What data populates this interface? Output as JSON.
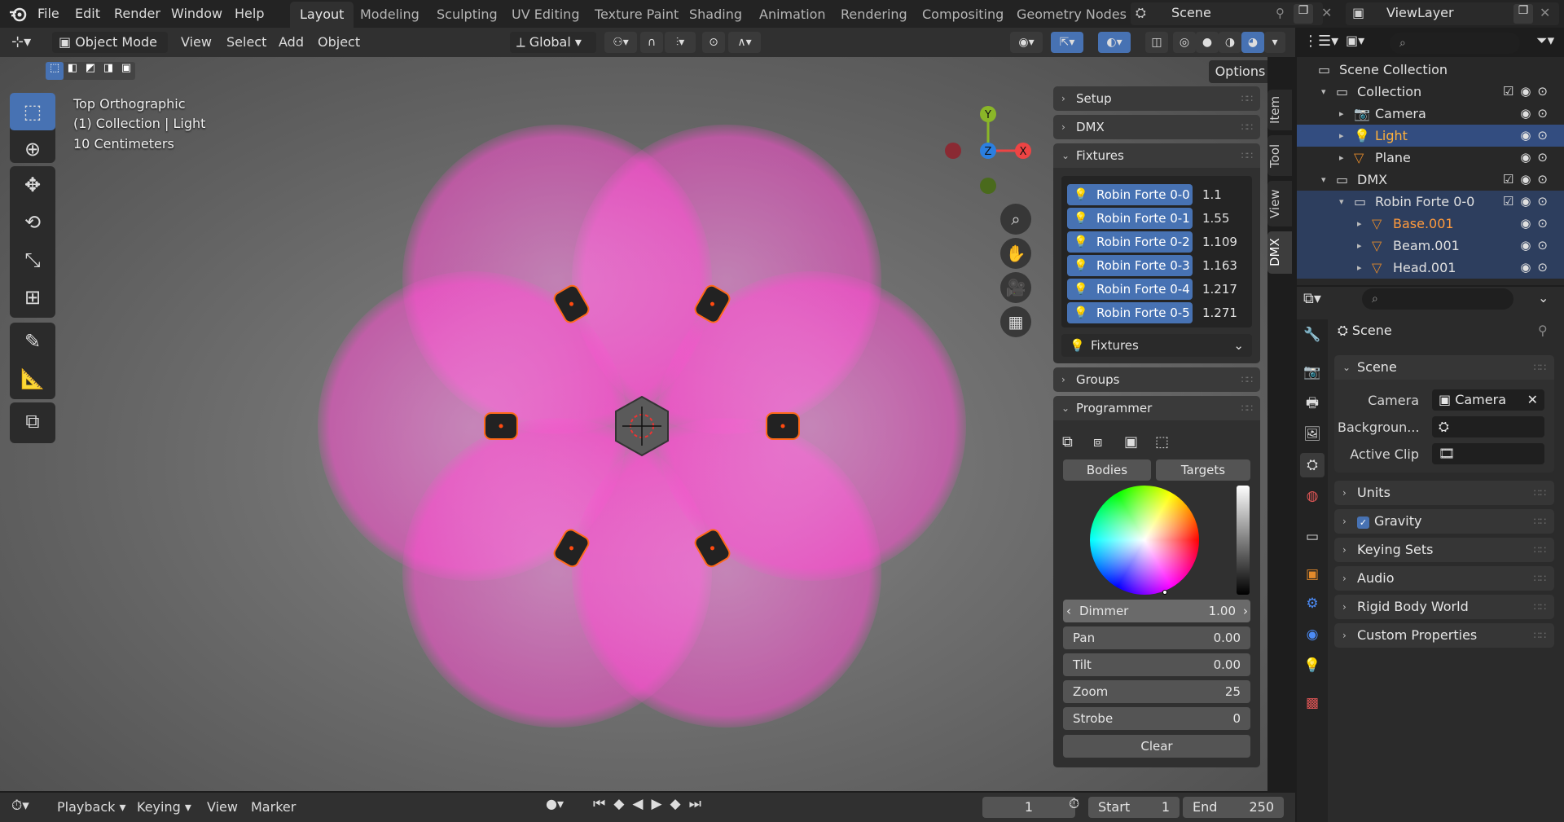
{
  "topbar": {
    "menus": [
      "File",
      "Edit",
      "Render",
      "Window",
      "Help"
    ],
    "workspaces": [
      "Layout",
      "Modeling",
      "Sculpting",
      "UV Editing",
      "Texture Paint",
      "Shading",
      "Animation",
      "Rendering",
      "Compositing",
      "Geometry Nodes"
    ],
    "active_workspace": "Layout",
    "scene": "Scene",
    "view_layer": "ViewLayer"
  },
  "header": {
    "mode": "Object Mode",
    "menus": [
      "View",
      "Select",
      "Add",
      "Object"
    ],
    "transform_orientation": "Global",
    "options_label": "Options"
  },
  "viewport": {
    "view_name": "Top Orthographic",
    "collection_info": "(1) Collection | Light",
    "scale_info": "10 Centimeters",
    "gizmo": {
      "x": "X",
      "y": "Y",
      "z": "Z"
    },
    "light_color": "#ff5fd8",
    "fixture_count": 6
  },
  "side_tabs": [
    "Item",
    "Tool",
    "View",
    "DMX"
  ],
  "active_side_tab": "DMX",
  "dmx_panel": {
    "setup": "Setup",
    "dmx": "DMX",
    "fixtures_header": "Fixtures",
    "fixtures": [
      {
        "name": "Robin Forte 0-0",
        "value": "1.1"
      },
      {
        "name": "Robin Forte 0-1",
        "value": "1.55"
      },
      {
        "name": "Robin Forte 0-2",
        "value": "1.109"
      },
      {
        "name": "Robin Forte 0-3",
        "value": "1.163"
      },
      {
        "name": "Robin Forte 0-4",
        "value": "1.217"
      },
      {
        "name": "Robin Forte 0-5",
        "value": "1.271"
      }
    ],
    "fixtures_dropdown": "Fixtures",
    "groups": "Groups",
    "programmer": "Programmer",
    "bodies": "Bodies",
    "targets": "Targets",
    "sliders": [
      {
        "label": "Dimmer",
        "value": "1.00"
      },
      {
        "label": "Pan",
        "value": "0.00"
      },
      {
        "label": "Tilt",
        "value": "0.00"
      },
      {
        "label": "Zoom",
        "value": "25"
      },
      {
        "label": "Strobe",
        "value": "0"
      }
    ],
    "clear": "Clear"
  },
  "outliner": {
    "rows": [
      {
        "label": "Scene Collection",
        "indent": 0
      },
      {
        "label": "Collection",
        "indent": 1
      },
      {
        "label": "Camera",
        "indent": 2
      },
      {
        "label": "Light",
        "indent": 2
      },
      {
        "label": "Plane",
        "indent": 2
      },
      {
        "label": "DMX",
        "indent": 1
      },
      {
        "label": "Robin Forte 0-0",
        "indent": 2
      },
      {
        "label": "Base.001",
        "indent": 3
      },
      {
        "label": "Beam.001",
        "indent": 3
      },
      {
        "label": "Head.001",
        "indent": 3
      }
    ]
  },
  "properties": {
    "context": "Scene",
    "scene_panel": "Scene",
    "camera_label": "Camera",
    "camera_value": "Camera",
    "background_label": "Backgroun...",
    "active_clip_label": "Active Clip",
    "panels": [
      "Units",
      "Gravity",
      "Keying Sets",
      "Audio",
      "Rigid Body World",
      "Custom Properties"
    ]
  },
  "timeline": {
    "menus": [
      "Playback",
      "Keying",
      "View",
      "Marker"
    ],
    "current_frame": "1",
    "start_label": "Start",
    "start": "1",
    "end_label": "End",
    "end": "250"
  }
}
